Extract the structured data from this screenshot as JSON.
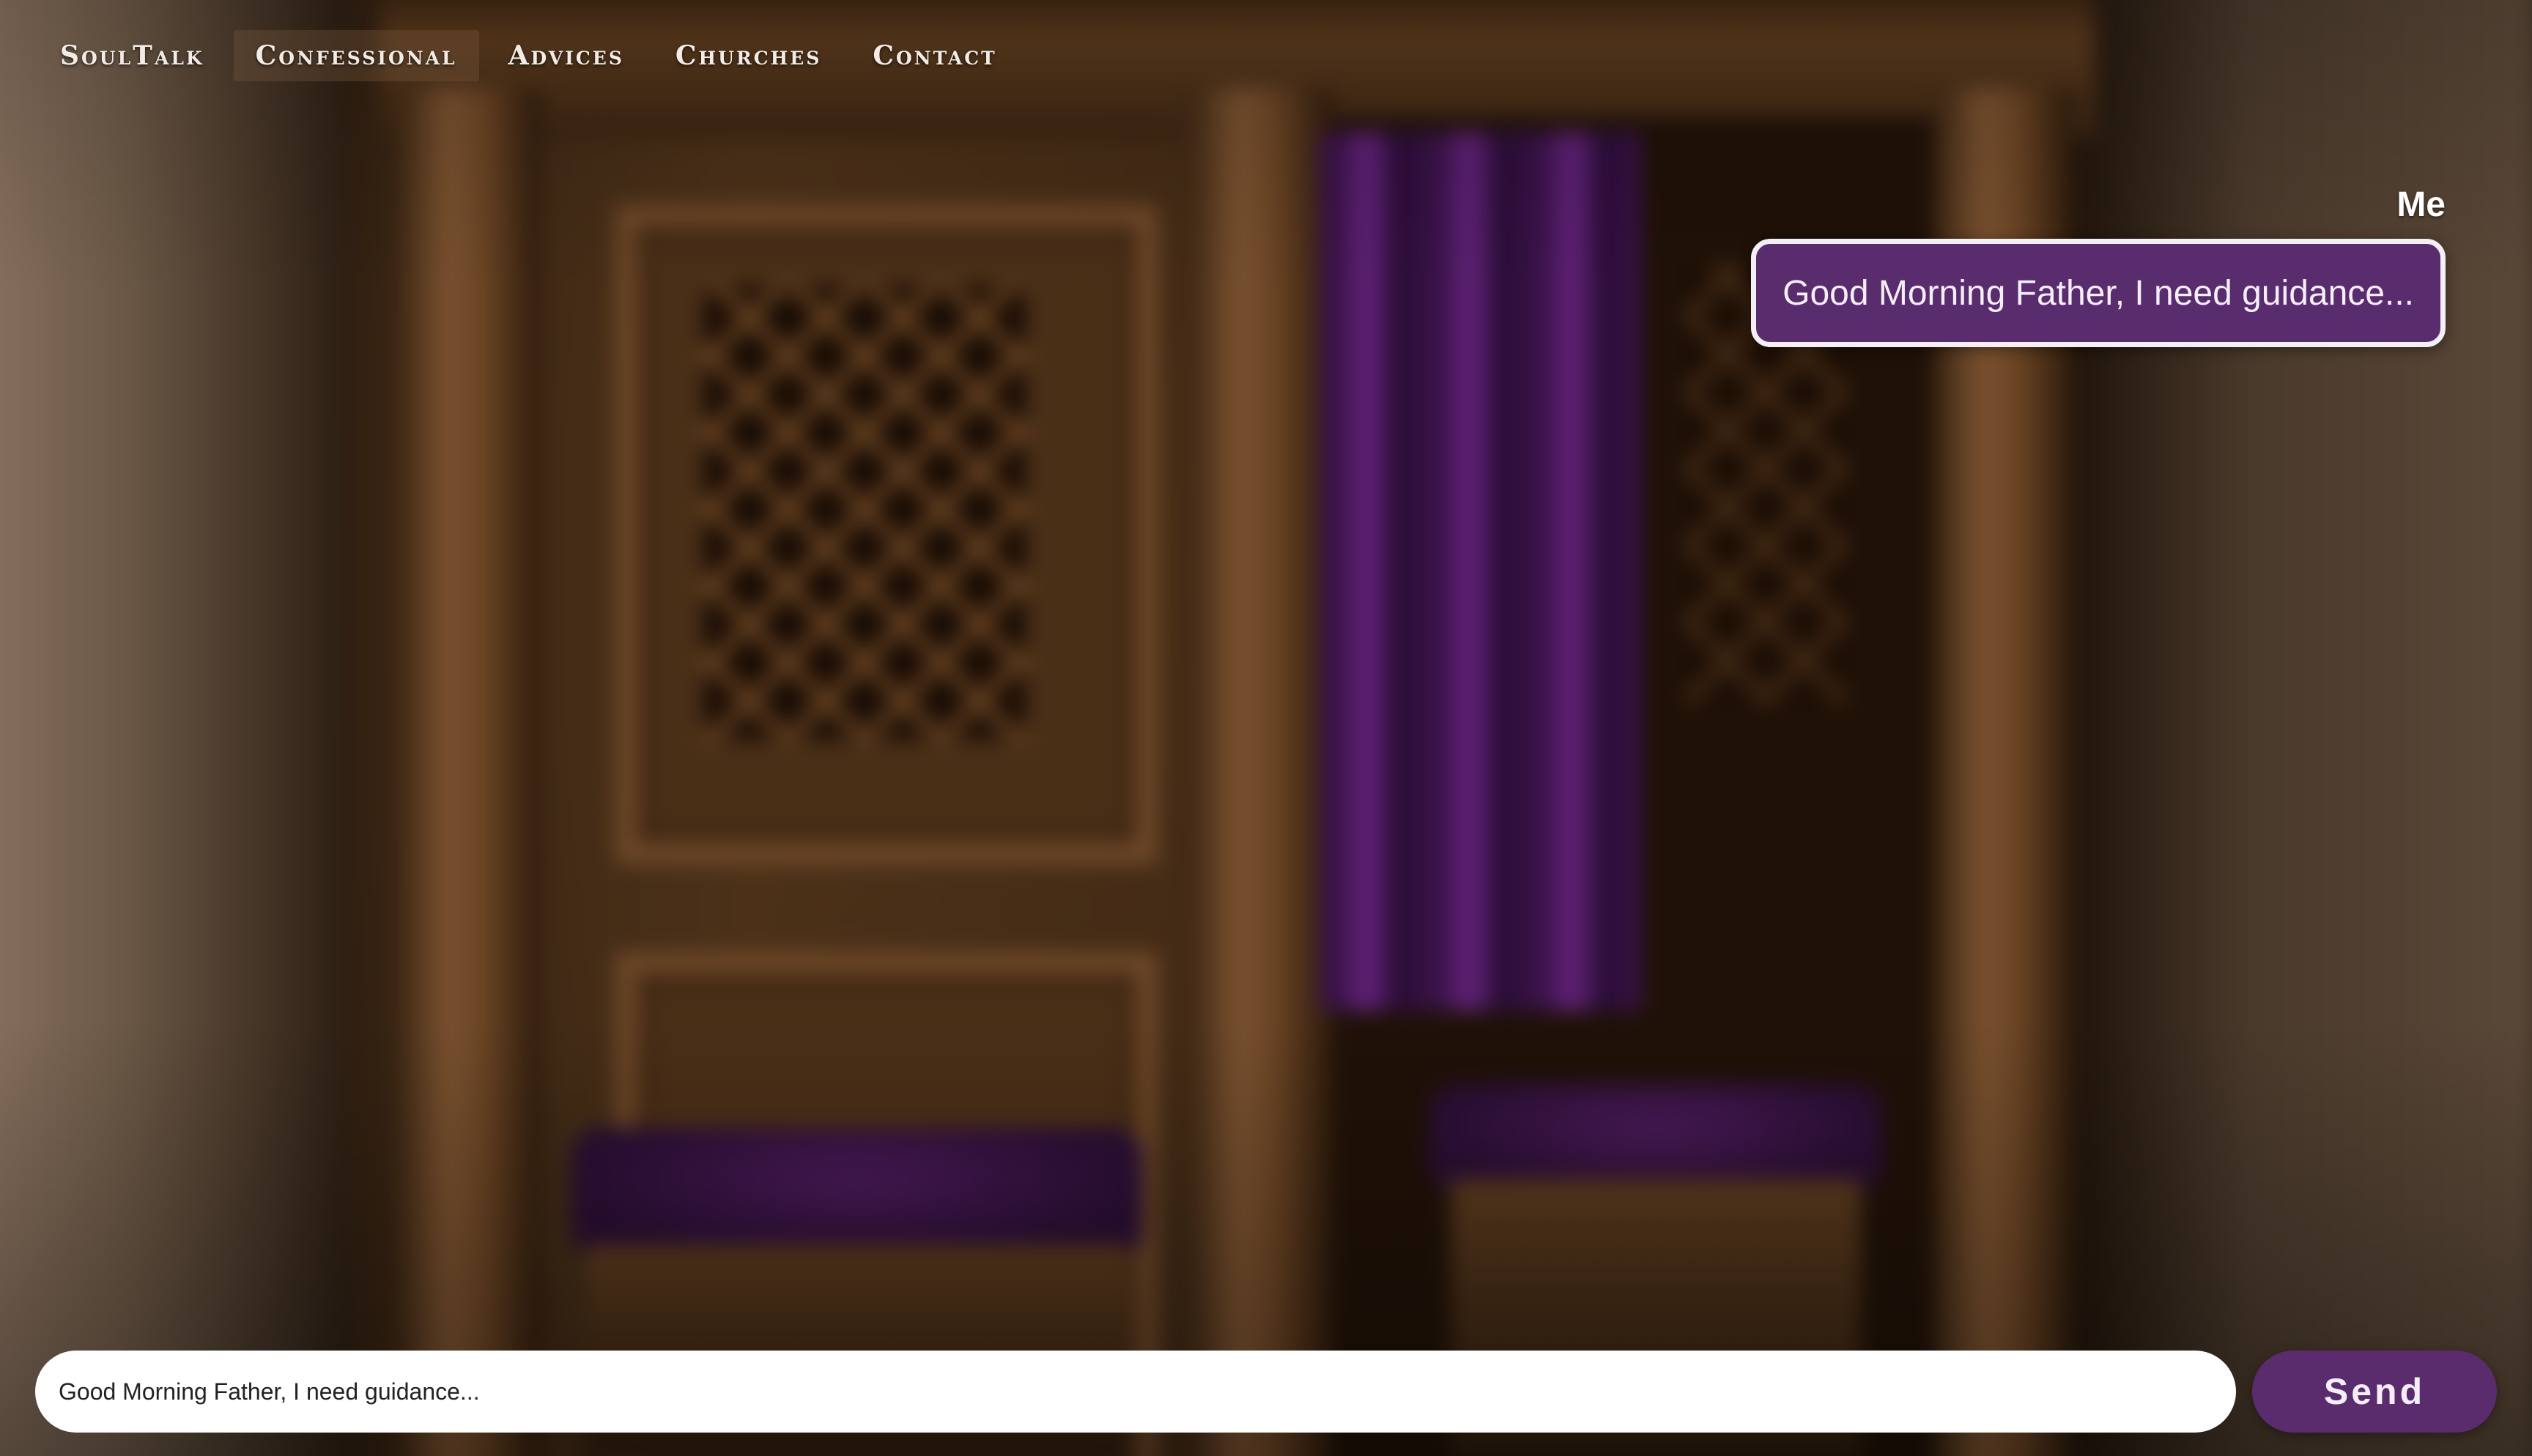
{
  "nav": {
    "brand": "SoulTalk",
    "items": [
      {
        "label": "Confessional",
        "active": true
      },
      {
        "label": "Advices",
        "active": false
      },
      {
        "label": "Churches",
        "active": false
      },
      {
        "label": "Contact",
        "active": false
      }
    ]
  },
  "chat": {
    "messages": [
      {
        "sender": "Me",
        "text": "Good Morning Father, I need guidance..."
      }
    ]
  },
  "composer": {
    "input_value": "Good Morning Father, I need guidance...",
    "send_label": "Send"
  },
  "colors": {
    "accent": "#592c6e",
    "bubble_border": "#f4eef6",
    "input_bg": "#ffffff"
  }
}
